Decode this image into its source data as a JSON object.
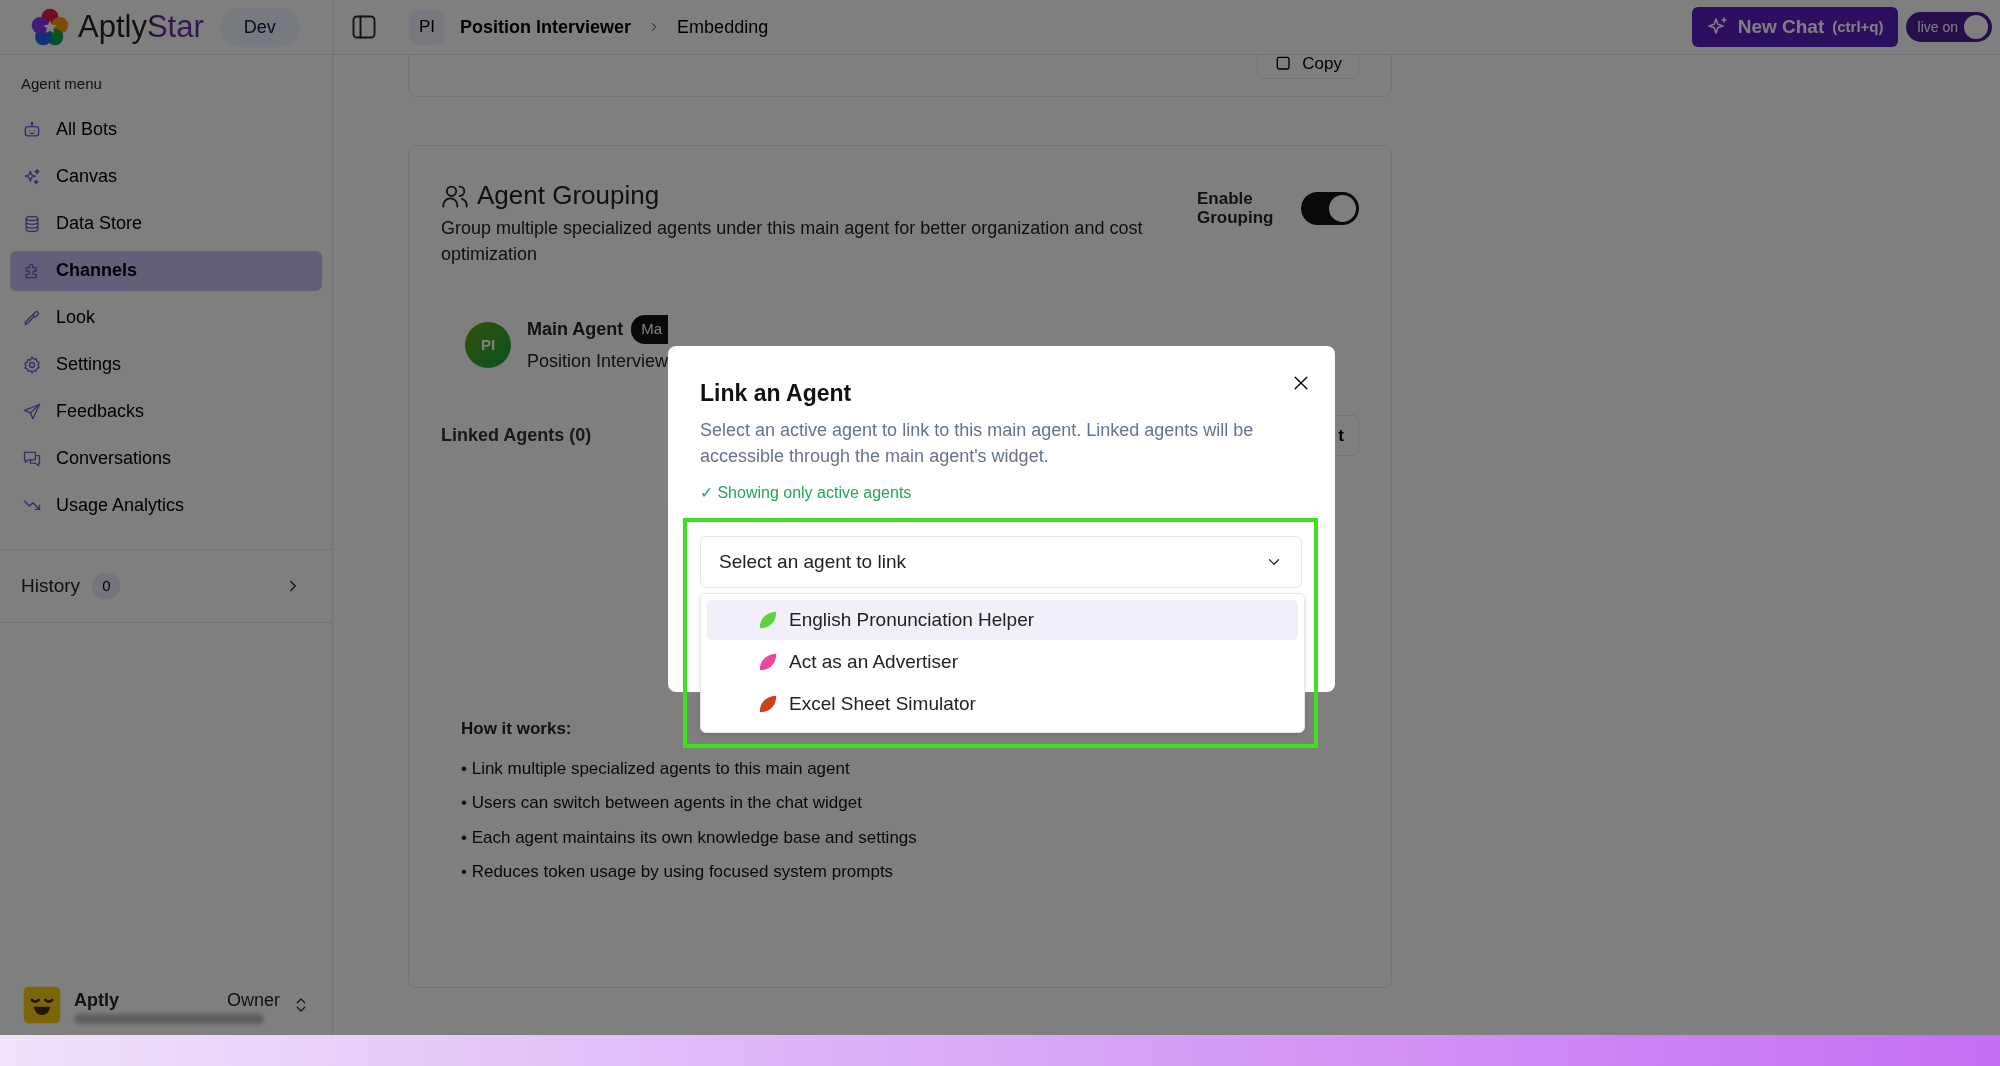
{
  "header": {
    "logo_text": "AptlyStar",
    "env_badge": "Dev",
    "project_initials": "PI",
    "breadcrumb": [
      "Position Interviewer",
      "Embedding"
    ],
    "new_chat": {
      "label": "New Chat",
      "shortcut": "(ctrl+q)"
    },
    "live_toggle": {
      "label": "live on",
      "on": true
    }
  },
  "sidebar": {
    "heading": "Agent menu",
    "items": [
      {
        "label": "All Bots",
        "selected": false
      },
      {
        "label": "Canvas",
        "selected": false
      },
      {
        "label": "Data Store",
        "selected": false
      },
      {
        "label": "Channels",
        "selected": true
      },
      {
        "label": "Look",
        "selected": false
      },
      {
        "label": "Settings",
        "selected": false
      },
      {
        "label": "Feedbacks",
        "selected": false
      },
      {
        "label": "Conversations",
        "selected": false
      },
      {
        "label": "Usage Analytics",
        "selected": false
      }
    ],
    "history": {
      "label": "History",
      "count": "0"
    },
    "user": {
      "name": "Aptly",
      "role": "Owner"
    }
  },
  "top_card": {
    "copy_button": "Copy"
  },
  "grouping": {
    "title": "Agent Grouping",
    "description": "Group multiple specialized agents under this main agent for better organization and cost optimization",
    "toggle": {
      "label": "Enable Grouping",
      "on": true
    },
    "main_agent": {
      "initials": "PI",
      "label": "Main Agent",
      "badge": "Ma",
      "name": "Position Interview"
    },
    "linked_heading": "Linked Agents (0)",
    "linked_button": "t",
    "how_title": "How it works:",
    "how_items": [
      "• Link multiple specialized agents to this main agent",
      "• Users can switch between agents in the chat widget",
      "• Each agent maintains its own knowledge base and settings",
      "• Reduces token usage by using focused system prompts"
    ]
  },
  "modal": {
    "title": "Link an Agent",
    "description": "Select an active agent to link to this main agent. Linked agents will be accessible through the main agent's widget.",
    "note": "✓ Showing only active agents",
    "select": {
      "placeholder": "Select an agent to link",
      "expanded": true
    },
    "options": [
      {
        "label": "English Pronunciation Helper",
        "color": "#5fd23f",
        "selected": true
      },
      {
        "label": "Act as an Advertiser",
        "color": "#ec4899",
        "selected": false
      },
      {
        "label": "Excel Sheet Simulator",
        "color": "#c9401a",
        "selected": false
      }
    ]
  }
}
